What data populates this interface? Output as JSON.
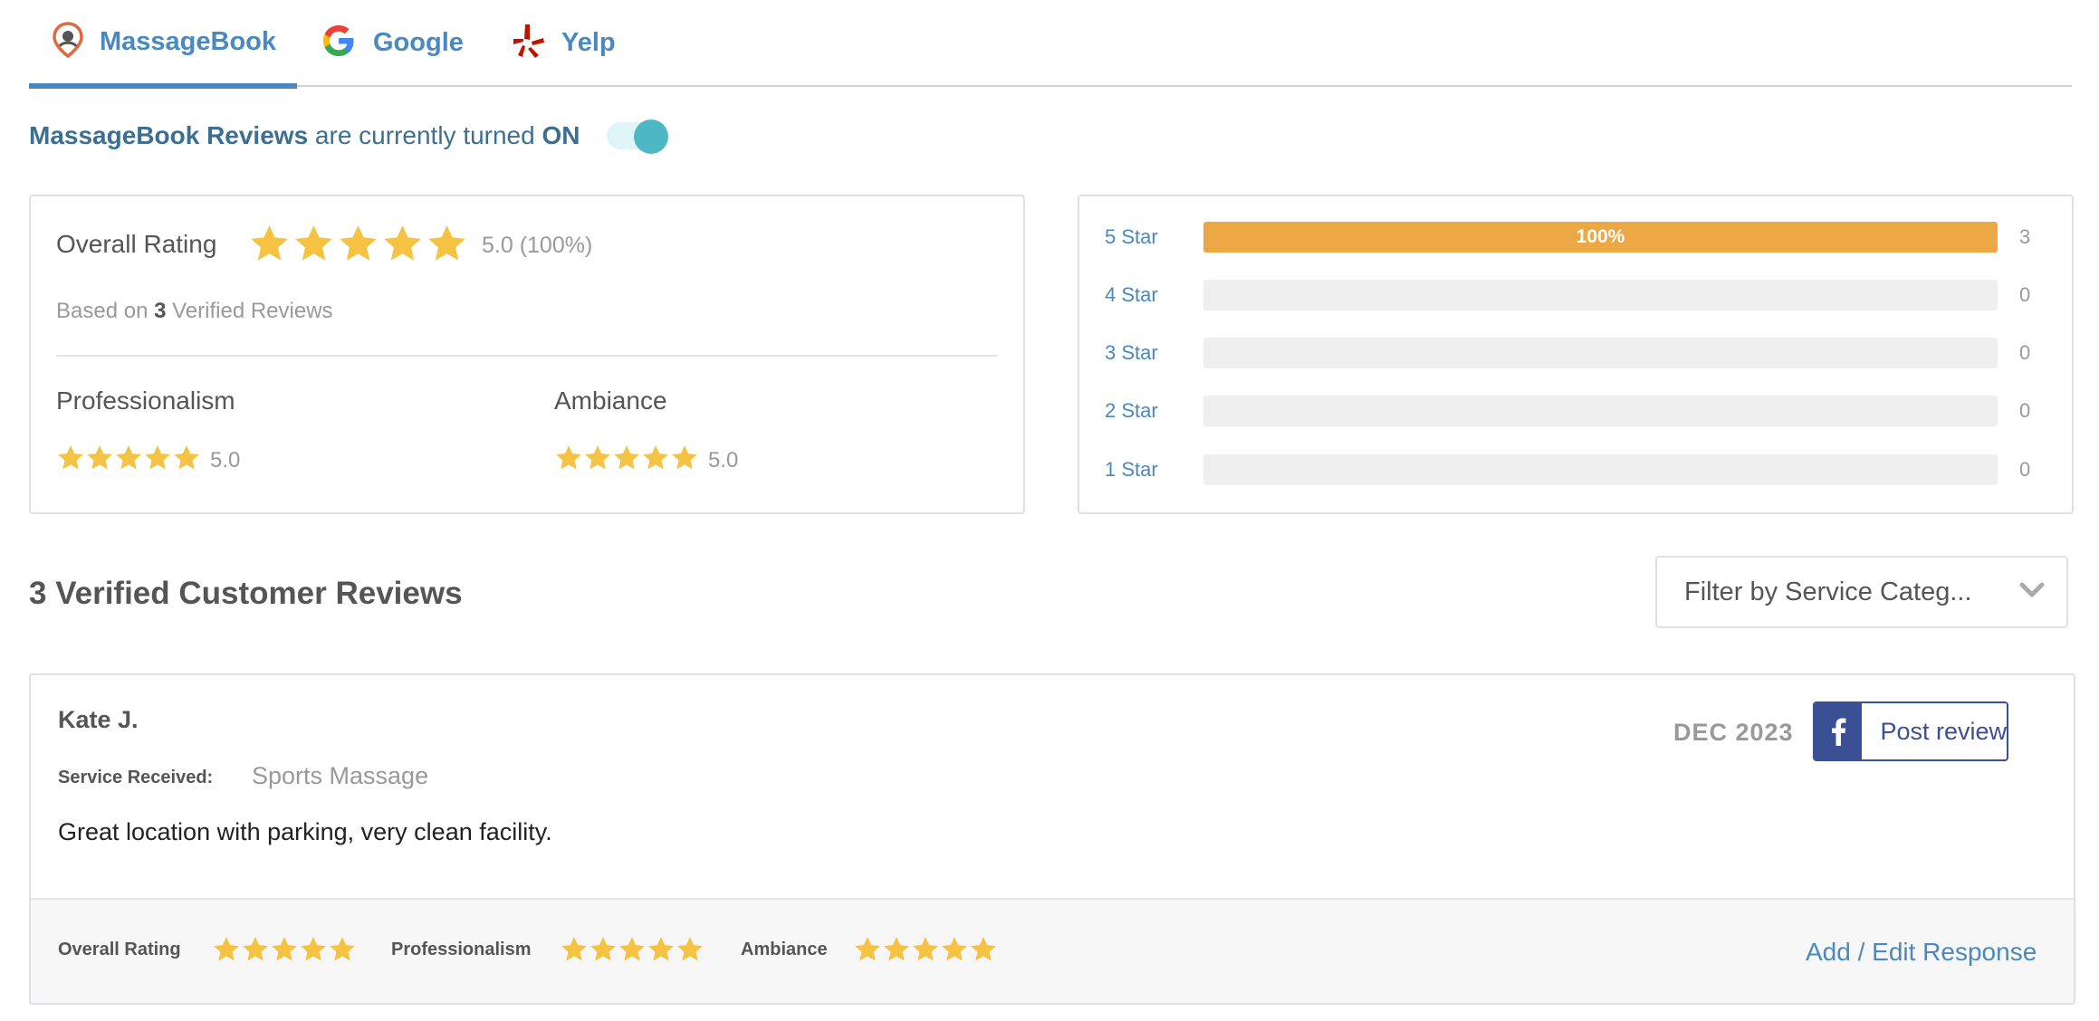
{
  "tabs": [
    {
      "label": "MassageBook",
      "icon": "massagebook-pin-icon",
      "active": true
    },
    {
      "label": "Google",
      "icon": "google-g-icon",
      "active": false
    },
    {
      "label": "Yelp",
      "icon": "yelp-burst-icon",
      "active": false
    }
  ],
  "status": {
    "brand": "MassageBook Reviews",
    "middle": " are currently turned ",
    "state": "ON",
    "toggle_on": true
  },
  "summary": {
    "overall_label": "Overall Rating",
    "overall_stars": 5,
    "overall_value": "5.0 (100%)",
    "based_prefix": "Based on ",
    "based_count": "3",
    "based_suffix": " Verified Reviews",
    "subratings": [
      {
        "label": "Professionalism",
        "stars": 5,
        "value": "5.0"
      },
      {
        "label": "Ambiance",
        "stars": 5,
        "value": "5.0"
      }
    ]
  },
  "distribution": [
    {
      "label": "5 Star",
      "percent": 100,
      "percent_label": "100%",
      "count": "3"
    },
    {
      "label": "4 Star",
      "percent": 0,
      "percent_label": "",
      "count": "0"
    },
    {
      "label": "3 Star",
      "percent": 0,
      "percent_label": "",
      "count": "0"
    },
    {
      "label": "2 Star",
      "percent": 0,
      "percent_label": "",
      "count": "0"
    },
    {
      "label": "1 Star",
      "percent": 0,
      "percent_label": "",
      "count": "0"
    }
  ],
  "reviews_heading": "3 Verified Customer Reviews",
  "filter": {
    "label": "Filter by Service Categ..."
  },
  "review": {
    "reviewer": "Kate J.",
    "service_label": "Service Received:",
    "service_value": "Sports Massage",
    "text": "Great location with parking, very clean facility.",
    "date": "DEC 2023",
    "post_label": "Post review",
    "ratings": [
      {
        "label": "Overall Rating",
        "stars": 5
      },
      {
        "label": "Professionalism",
        "stars": 5
      },
      {
        "label": "Ambiance",
        "stars": 5
      }
    ],
    "response_link": "Add / Edit Response"
  },
  "colors": {
    "accent": "#4a89c0",
    "star": "#f5c242",
    "bar_fill": "#eba844",
    "toggle": "#4db8c3",
    "facebook": "#3b4f94"
  }
}
